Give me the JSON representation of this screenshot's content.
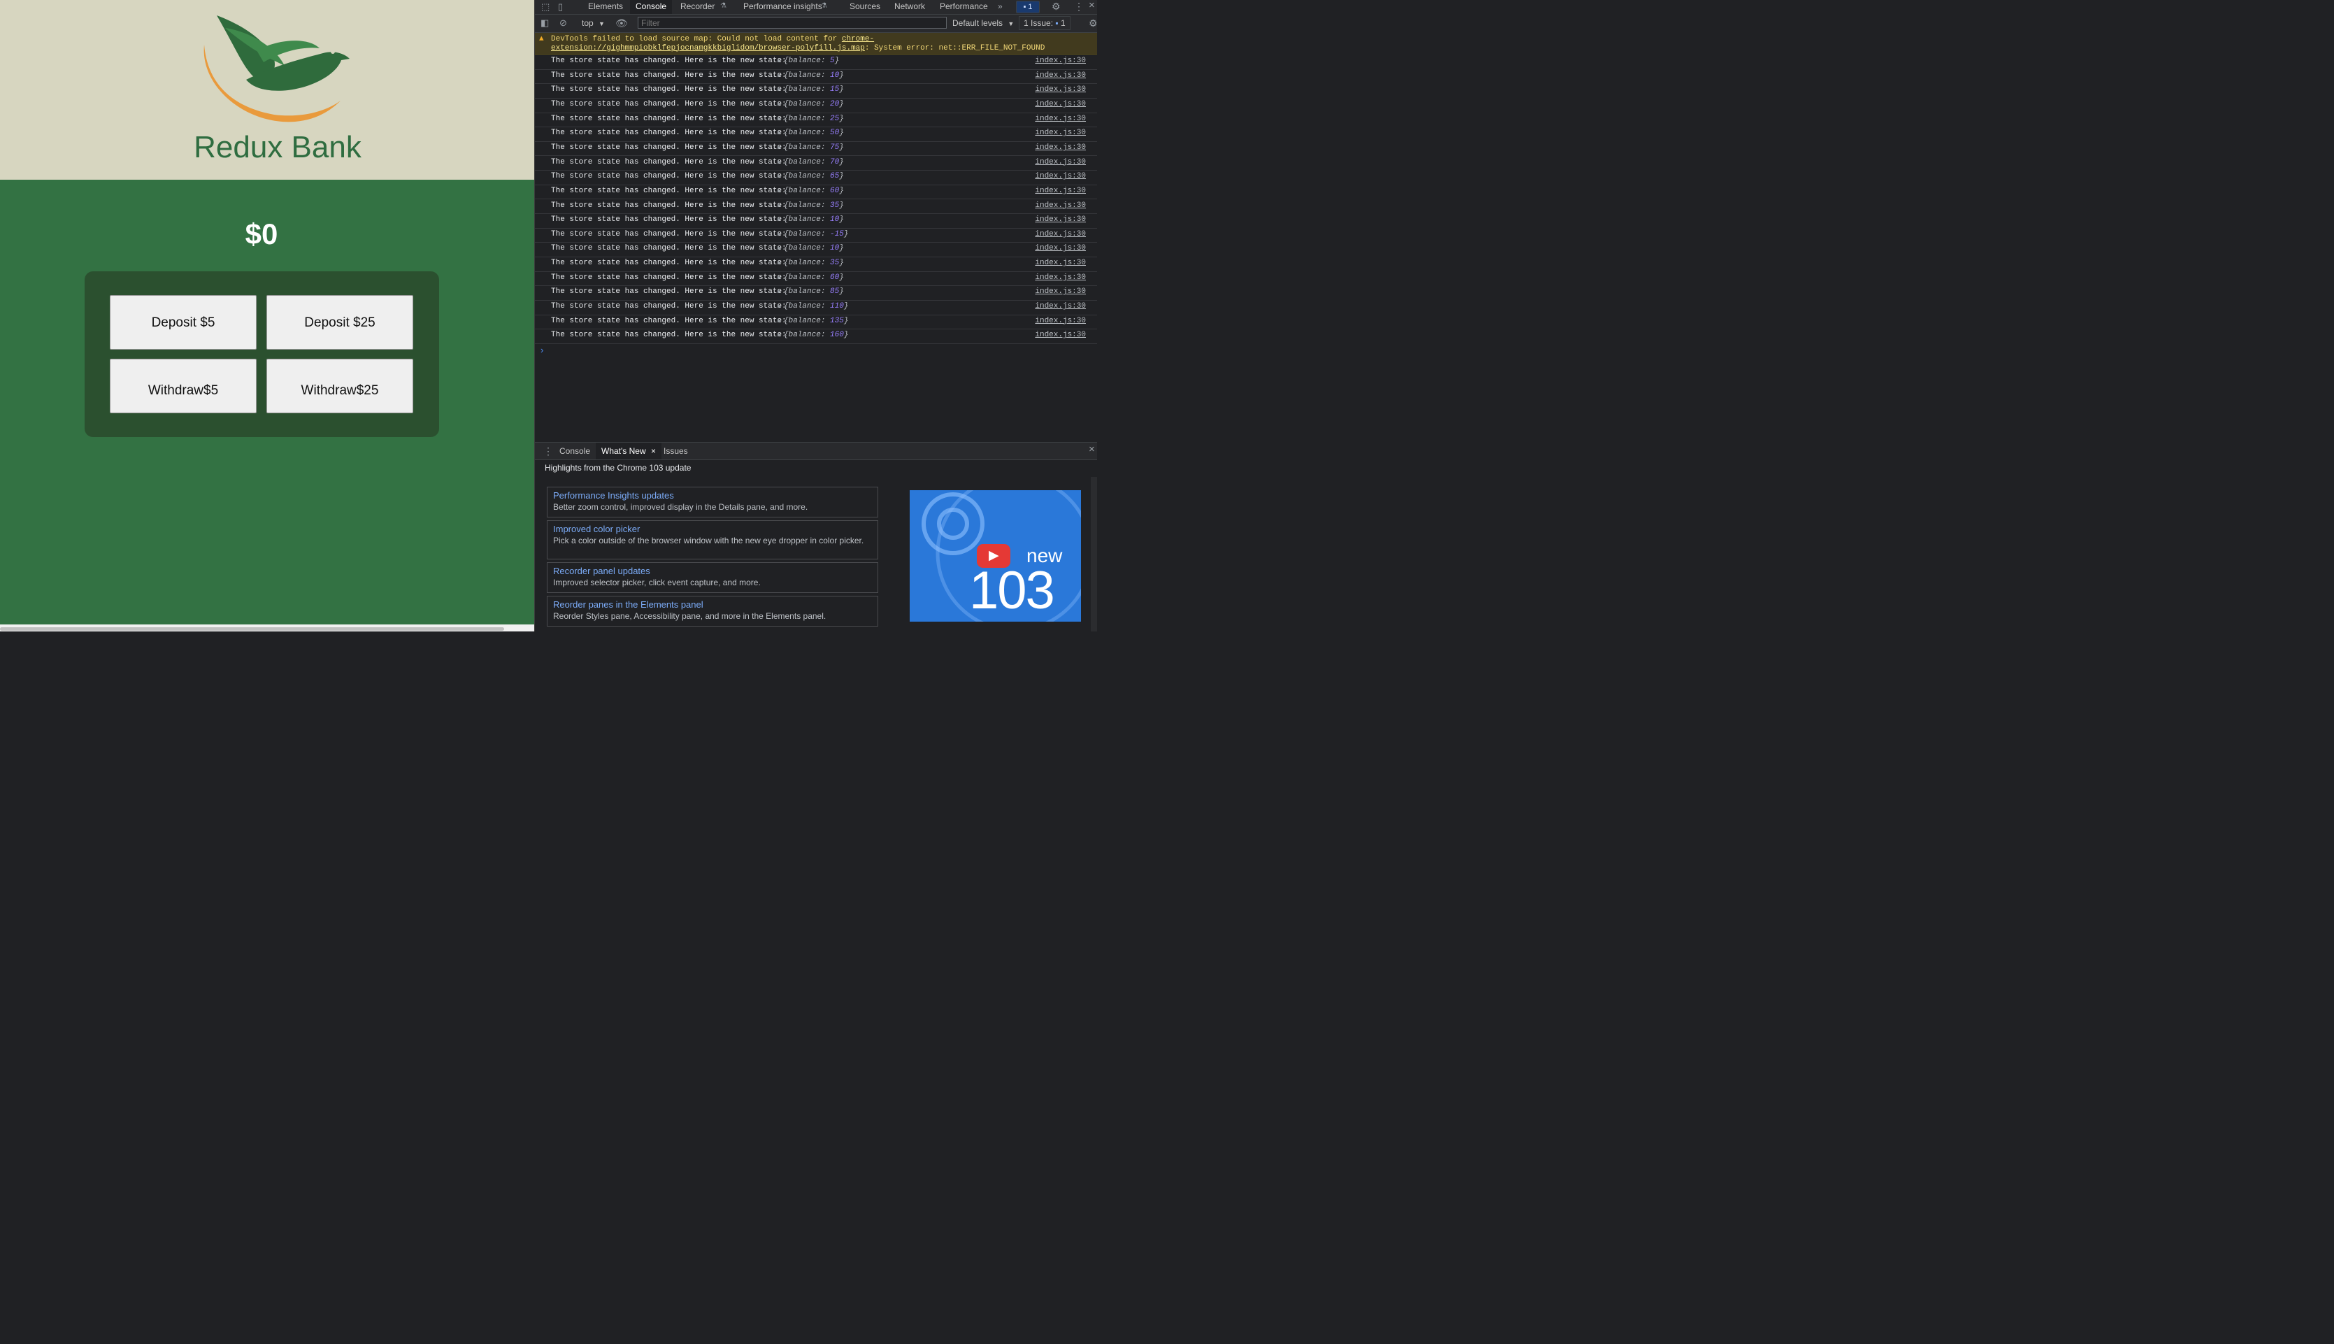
{
  "app": {
    "title": "Redux Bank",
    "balance": "$0",
    "buttons": {
      "deposit5": "Deposit $5",
      "deposit25": "Deposit $25",
      "withdraw5_line1": "Withdraw",
      "withdraw5_line2": "$5",
      "withdraw25_line1": "Withdraw",
      "withdraw25_line2": "$25"
    }
  },
  "devtools": {
    "tabs": [
      "Elements",
      "Console",
      "Recorder",
      "Performance insights",
      "Sources",
      "Network",
      "Performance"
    ],
    "more_tabs": "»",
    "message_badge": "1",
    "toolbar": {
      "context": "top",
      "filter_placeholder": "Filter",
      "levels": "Default levels",
      "issues_label": "1 Issue:",
      "issues_count": "1"
    },
    "warning": {
      "prefix": "DevTools failed to load source map: Could not load content for ",
      "url": "chrome-extension://gighmmpiobklfepjocnamgkkbiglidom/browser-polyfill.js.map",
      "suffix": ": System error: net::ERR_FILE_NOT_FOUND"
    },
    "log_message": "The store state has changed. Here is the new state:",
    "log_key": "balance",
    "log_source": "index.js:30",
    "balances": [
      "5",
      "10",
      "15",
      "20",
      "25",
      "50",
      "75",
      "70",
      "65",
      "60",
      "35",
      "10",
      "-15",
      "10",
      "35",
      "60",
      "85",
      "110",
      "135",
      "160"
    ],
    "prompt": "›",
    "drawer": {
      "tabs": [
        "Console",
        "What's New",
        "Issues"
      ],
      "close": "×",
      "heading": "Highlights from the Chrome 103 update",
      "cards": [
        {
          "title": "Performance Insights updates",
          "desc": "Better zoom control, improved display in the Details pane, and more."
        },
        {
          "title": "Improved color picker",
          "desc": "Pick a color outside of the browser window with the new eye dropper in color picker."
        },
        {
          "title": "Recorder panel updates",
          "desc": "Improved selector picker, click event capture, and more."
        },
        {
          "title": "Reorder panes in the Elements panel",
          "desc": "Reorder Styles pane, Accessibility pane, and more in the Elements panel."
        }
      ],
      "promo_word": "new",
      "promo_number": "103"
    }
  }
}
